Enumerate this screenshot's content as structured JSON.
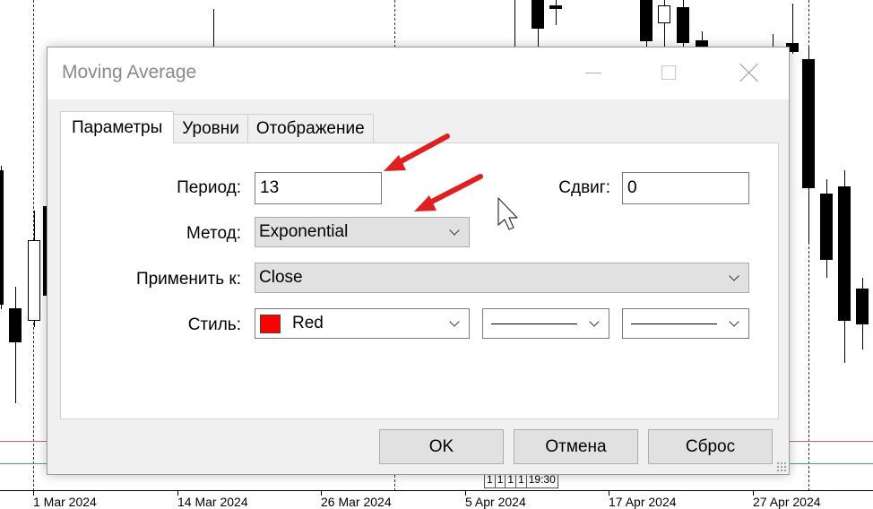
{
  "chart": {
    "x_labels": [
      "1 Mar 2024",
      "14 Mar 2024",
      "26 Mar 2024",
      "5 Apr 2024",
      "17 Apr 2024",
      "27 Apr 2024"
    ],
    "strip_values": [
      "1",
      "1",
      "1",
      "1",
      "19:30"
    ]
  },
  "dialog": {
    "title": "Moving Average",
    "tabs": [
      "Параметры",
      "Уровни",
      "Отображение"
    ],
    "fields": {
      "period_label": "Период:",
      "period_value": "13",
      "shift_label": "Сдвиг:",
      "shift_value": "0",
      "method_label": "Метод:",
      "method_value": "Exponential",
      "apply_label": "Применить к:",
      "apply_value": "Close",
      "style_label": "Стиль:",
      "color_value": "Red"
    },
    "buttons": {
      "ok": "OK",
      "cancel": "Отмена",
      "reset": "Сброс"
    }
  },
  "colors": {
    "swatch": "#ff0000",
    "annotation_arrow": "#e02020",
    "level_line_red": "#e06060",
    "level_line_teal": "#40a0a0"
  },
  "icons": {
    "minimize": "minimize-icon",
    "maximize": "maximize-icon",
    "close": "close-icon",
    "dropdown": "chevron-down-icon",
    "cursor": "mouse-cursor-icon",
    "annotation": "red-arrow-icon"
  }
}
